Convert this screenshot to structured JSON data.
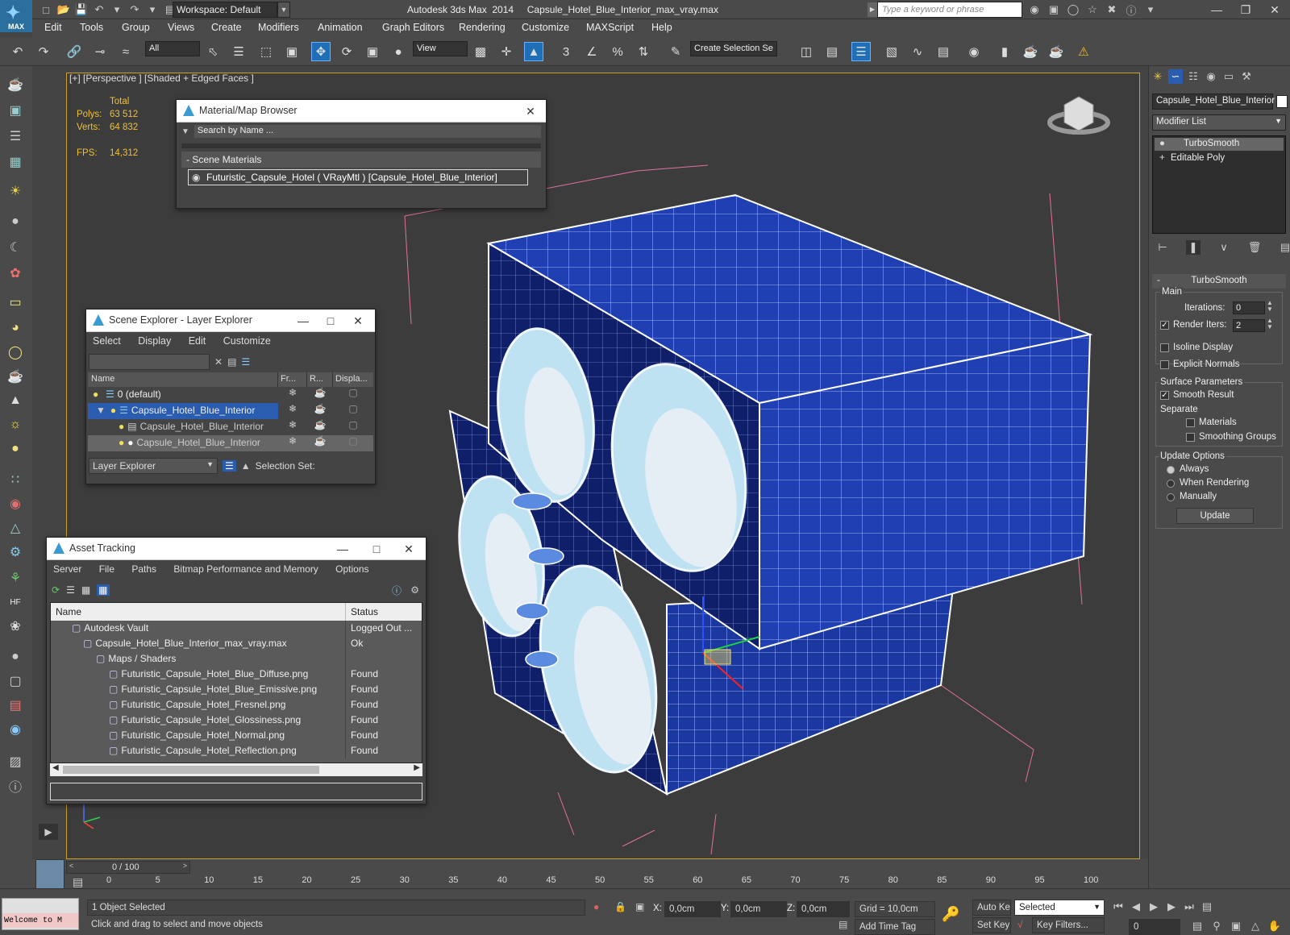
{
  "app": {
    "title": "Autodesk 3ds Max  2014     Capsule_Hotel_Blue_Interior_max_vray.max",
    "logo_text": "MAX",
    "workspace": "Workspace: Default",
    "search_placeholder": "Type a keyword or phrase"
  },
  "menu": [
    "Edit",
    "Tools",
    "Group",
    "Views",
    "Create",
    "Modifiers",
    "Animation",
    "Graph Editors",
    "Rendering",
    "Customize",
    "MAXScript",
    "Help"
  ],
  "toolbar": {
    "filter": "All",
    "refcoord": "View",
    "selset": "Create Selection Se",
    "snaps": [
      "3",
      "∠",
      "%"
    ]
  },
  "viewport": {
    "label": "[+] [Perspective ] [Shaded + Edged Faces ]",
    "stats": {
      "header": "Total",
      "polys_label": "Polys:",
      "polys": "63 512",
      "verts_label": "Verts:",
      "verts": "64 832",
      "fps_label": "FPS:",
      "fps": "14,312"
    }
  },
  "mat_browser": {
    "title": "Material/Map Browser",
    "search": "Search by Name ...",
    "section": "- Scene Materials",
    "item": "Futuristic_Capsule_Hotel  ( VRayMtl ) [Capsule_Hotel_Blue_Interior]"
  },
  "scene_explorer": {
    "title": "Scene Explorer - Layer Explorer",
    "menu": [
      "Select",
      "Display",
      "Edit",
      "Customize"
    ],
    "cols": [
      "Name",
      "Fr...",
      "R...",
      "Displa..."
    ],
    "rows": [
      "0 (default)",
      "Capsule_Hotel_Blue_Interior",
      "Capsule_Hotel_Blue_Interior",
      "Capsule_Hotel_Blue_Interior"
    ],
    "footer": "Layer Explorer",
    "selset": "Selection Set:"
  },
  "asset_tracking": {
    "title": "Asset Tracking",
    "menu": [
      "Server",
      "File",
      "Paths",
      "Bitmap Performance and Memory",
      "Options"
    ],
    "cols": [
      "Name",
      "Status"
    ],
    "rows": [
      {
        "name": "Autodesk Vault",
        "status": "Logged Out ..."
      },
      {
        "name": "Capsule_Hotel_Blue_Interior_max_vray.max",
        "status": "Ok"
      },
      {
        "name": "Maps / Shaders",
        "status": ""
      },
      {
        "name": "Futuristic_Capsule_Hotel_Blue_Diffuse.png",
        "status": "Found"
      },
      {
        "name": "Futuristic_Capsule_Hotel_Blue_Emissive.png",
        "status": "Found"
      },
      {
        "name": "Futuristic_Capsule_Hotel_Fresnel.png",
        "status": "Found"
      },
      {
        "name": "Futuristic_Capsule_Hotel_Glossiness.png",
        "status": "Found"
      },
      {
        "name": "Futuristic_Capsule_Hotel_Normal.png",
        "status": "Found"
      },
      {
        "name": "Futuristic_Capsule_Hotel_Reflection.png",
        "status": "Found"
      }
    ]
  },
  "cmd": {
    "object": "Capsule_Hotel_Blue_Interior",
    "modlist": "Modifier List",
    "stack": [
      "TurboSmooth",
      "Editable Poly"
    ],
    "rollout": "TurboSmooth",
    "main": "Main",
    "iterations_label": "Iterations:",
    "iterations": "0",
    "render_iters_label": "Render Iters:",
    "render_iters": "2",
    "isoline": "Isoline Display",
    "explicit": "Explicit Normals",
    "surface": "Surface Parameters",
    "smooth": "Smooth Result",
    "separate": "Separate",
    "materials": "Materials",
    "smoothing": "Smoothing Groups",
    "update_opts": "Update Options",
    "always": "Always",
    "when_rendering": "When Rendering",
    "manually": "Manually",
    "update": "Update"
  },
  "timeline": {
    "frame": "0 / 100",
    "ticks": [
      "0",
      "5",
      "10",
      "15",
      "20",
      "25",
      "30",
      "35",
      "40",
      "45",
      "50",
      "55",
      "60",
      "65",
      "70",
      "75",
      "80",
      "85",
      "90",
      "95",
      "100"
    ]
  },
  "status": {
    "welcome": "Welcome to M",
    "selected": "1 Object Selected",
    "hint": "Click and drag to select and move objects",
    "x_label": "X:",
    "x": "0,0cm",
    "y_label": "Y:",
    "y": "0,0cm",
    "z_label": "Z:",
    "z": "0,0cm",
    "grid": "Grid = 10,0cm",
    "add_time_tag": "Add Time Tag",
    "auto_key": "Auto Key",
    "set_key": "Set Key",
    "key_mode": "Selected",
    "key_filters": "Key Filters...",
    "frame": "0"
  }
}
